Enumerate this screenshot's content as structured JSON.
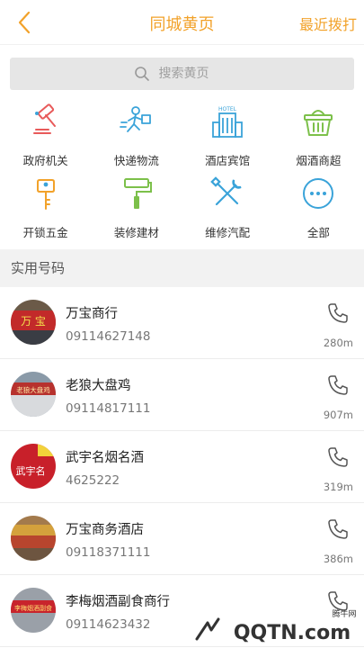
{
  "header": {
    "title": "同城黄页",
    "recent_label": "最近拨打"
  },
  "search": {
    "placeholder": "搜索黄页"
  },
  "categories": [
    {
      "label": "政府机关",
      "icon": "gavel-icon"
    },
    {
      "label": "快递物流",
      "icon": "courier-icon"
    },
    {
      "label": "酒店宾馆",
      "icon": "hotel-icon"
    },
    {
      "label": "烟酒商超",
      "icon": "shopping-basket-icon"
    },
    {
      "label": "开锁五金",
      "icon": "key-icon"
    },
    {
      "label": "装修建材",
      "icon": "paint-roller-icon"
    },
    {
      "label": "维修汽配",
      "icon": "tools-icon"
    },
    {
      "label": "全部",
      "icon": "more-icon"
    }
  ],
  "section": {
    "title": "实用号码"
  },
  "listings": [
    {
      "name": "万宝商行",
      "phone": "09114627148",
      "distance": "280m",
      "sign_text": "万 宝"
    },
    {
      "name": "老狼大盘鸡",
      "phone": "09114817111",
      "distance": "907m",
      "sign_text": "老狼大盘鸡"
    },
    {
      "name": "武宇名烟名酒",
      "phone": "4625222",
      "distance": "319m",
      "sign_text": "武宇名"
    },
    {
      "name": "万宝商务酒店",
      "phone": "09118371111",
      "distance": "386m",
      "sign_text": ""
    },
    {
      "name": "李梅烟酒副食商行",
      "phone": "09114623432",
      "distance": "",
      "sign_text": "李梅烟酒副食"
    }
  ],
  "watermark": {
    "text": "QQTN.com",
    "sub_text": "腾牛网"
  },
  "colors": {
    "accent": "#f2a22a",
    "icon_red": "#e85a5a",
    "icon_blue": "#3aa3d9",
    "icon_green": "#7cc04a",
    "icon_orange": "#f2a22a"
  }
}
